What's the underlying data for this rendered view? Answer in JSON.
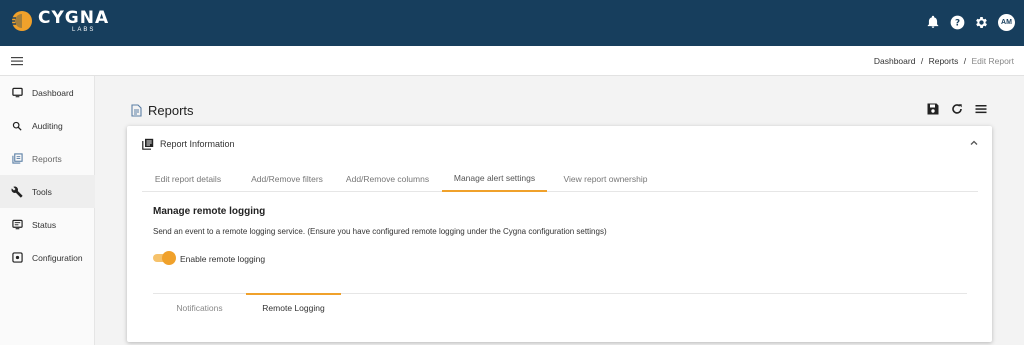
{
  "colors": {
    "header_bg": "#173e5d",
    "accent": "#f0a12b",
    "card_bg": "#ffffff"
  },
  "brand": {
    "name": "CYGNA",
    "sub": "LABS"
  },
  "header": {
    "icons": [
      "bell-icon",
      "help-icon",
      "settings-icon"
    ],
    "avatar": "AM"
  },
  "breadcrumb": {
    "items": [
      "Dashboard",
      "Reports"
    ],
    "current": "Edit Report",
    "separator": "/"
  },
  "sidebar": {
    "items": [
      {
        "label": "Dashboard",
        "icon": "monitor-icon"
      },
      {
        "label": "Auditing",
        "icon": "search-icon"
      },
      {
        "label": "Reports",
        "icon": "reports-icon"
      },
      {
        "label": "Tools",
        "icon": "wrench-icon"
      },
      {
        "label": "Status",
        "icon": "status-icon"
      },
      {
        "label": "Configuration",
        "icon": "configuration-icon"
      }
    ],
    "active": "Tools"
  },
  "page": {
    "title": "Reports",
    "actions": [
      "save-icon",
      "refresh-icon",
      "menu-icon"
    ]
  },
  "card": {
    "title": "Report Information",
    "tabs": [
      {
        "label": "Edit report details"
      },
      {
        "label": "Add/Remove filters"
      },
      {
        "label": "Add/Remove columns"
      },
      {
        "label": "Manage alert settings"
      },
      {
        "label": "View report ownership"
      }
    ],
    "active_tab": "Manage alert settings",
    "section": {
      "title": "Manage remote logging",
      "description": "Send an event to a remote logging service. (Ensure you have configured remote logging under the Cygna configuration settings)",
      "toggle_label": "Enable remote logging",
      "toggle_on": true
    },
    "subtabs": [
      {
        "label": "Notifications"
      },
      {
        "label": "Remote Logging"
      }
    ],
    "active_subtab": "Remote Logging"
  }
}
